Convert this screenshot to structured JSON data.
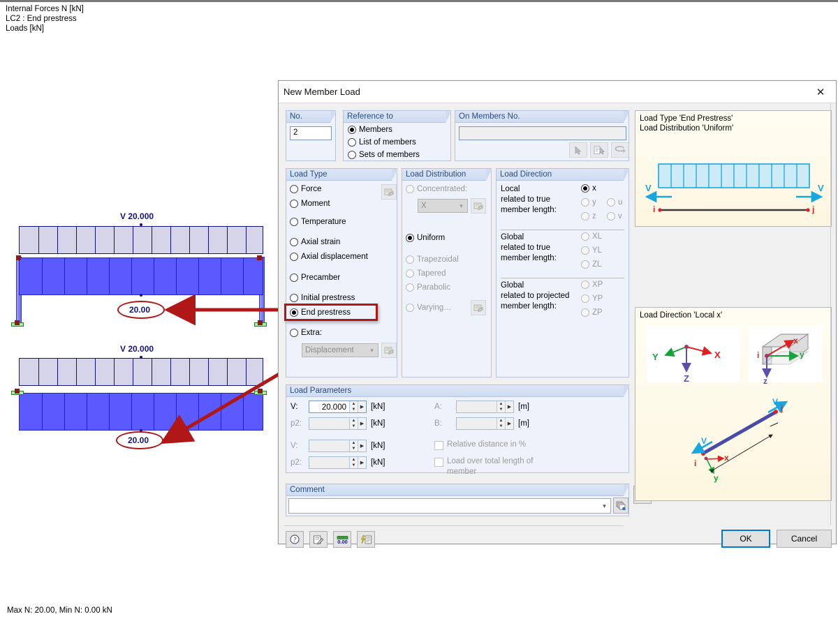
{
  "cad": {
    "header_lines": [
      "Internal Forces N [kN]",
      "LC2 : End prestress",
      "Loads [kN]"
    ],
    "status": "Max N: 20.00, Min N: 0.00 kN",
    "diagram_top": {
      "v_label": "V 20.000",
      "value_label": "20.00"
    },
    "diagram_bottom": {
      "v_label": "V 20.000",
      "value_label": "20.00"
    }
  },
  "dialog": {
    "title": "New Member Load",
    "close_icon": "close-icon",
    "no_group": {
      "title": "No.",
      "value": "2"
    },
    "reference_group": {
      "title": "Reference to",
      "options": [
        {
          "label": "Members",
          "selected": true
        },
        {
          "label": "List of members",
          "selected": false
        },
        {
          "label": "Sets of members",
          "selected": false
        }
      ]
    },
    "on_members_group": {
      "title": "On Members No.",
      "value": "",
      "buttons": [
        {
          "name": "pick-member-button"
        },
        {
          "name": "pick-member-list-button"
        },
        {
          "name": "select-all-button"
        }
      ]
    },
    "load_type_group": {
      "title": "Load Type",
      "options": [
        {
          "label": "Force",
          "selected": false,
          "disabled": false
        },
        {
          "label": "Moment",
          "selected": false,
          "disabled": false
        },
        {
          "label": "Temperature",
          "selected": false,
          "disabled": false
        },
        {
          "label": "Axial strain",
          "selected": false,
          "disabled": false
        },
        {
          "label": "Axial displacement",
          "selected": false,
          "disabled": false
        },
        {
          "label": "Precamber",
          "selected": false,
          "disabled": false
        },
        {
          "label": "Initial prestress",
          "selected": false,
          "disabled": false
        },
        {
          "label": "End prestress",
          "selected": true,
          "disabled": false,
          "highlight": true
        },
        {
          "label": "Extra:",
          "selected": false,
          "disabled": false
        }
      ],
      "extra_dropdown": {
        "value": "Displacement",
        "disabled": true
      },
      "settings_button": "settings-icon"
    },
    "load_distribution_group": {
      "title": "Load Distribution",
      "options": [
        {
          "label": "Concentrated:",
          "selected": false,
          "disabled": true
        },
        {
          "label": "Uniform",
          "selected": true,
          "disabled": false
        },
        {
          "label": "Trapezoidal",
          "selected": false,
          "disabled": true
        },
        {
          "label": "Tapered",
          "selected": false,
          "disabled": true
        },
        {
          "label": "Parabolic",
          "selected": false,
          "disabled": true
        },
        {
          "label": "Varying…",
          "selected": false,
          "disabled": true
        }
      ],
      "concentrated_dropdown": {
        "value": "X",
        "disabled": true
      }
    },
    "load_direction_group": {
      "title": "Load Direction",
      "sections": [
        {
          "label": "Local\nrelated to true\nmember length:",
          "options": [
            {
              "label": "x",
              "selected": true,
              "disabled": false
            },
            {
              "label": "u",
              "selected": false,
              "disabled": true
            },
            {
              "label": "y",
              "selected": false,
              "disabled": true
            },
            {
              "label": "v",
              "selected": false,
              "disabled": true
            },
            {
              "label": "z",
              "selected": false,
              "disabled": true
            }
          ]
        },
        {
          "label": "Global\nrelated to true\nmember length:",
          "options": [
            {
              "label": "XL",
              "selected": false,
              "disabled": true
            },
            {
              "label": "YL",
              "selected": false,
              "disabled": true
            },
            {
              "label": "ZL",
              "selected": false,
              "disabled": true
            }
          ]
        },
        {
          "label": "Global\nrelated to projected\nmember length:",
          "options": [
            {
              "label": "XP",
              "selected": false,
              "disabled": true
            },
            {
              "label": "YP",
              "selected": false,
              "disabled": true
            },
            {
              "label": "ZP",
              "selected": false,
              "disabled": true
            }
          ]
        }
      ],
      "local_label_l1": "Local",
      "local_label_l2": "related to true",
      "local_label_l3": "member length:",
      "global_true_l1": "Global",
      "global_true_l2": "related to true",
      "global_true_l3": "member length:",
      "global_proj_l1": "Global",
      "global_proj_l2": "related to projected",
      "global_proj_l3": "member length:"
    },
    "load_parameters_group": {
      "title": "Load Parameters",
      "fields": [
        {
          "label": "V:",
          "value": "20.000",
          "unit": "[kN]",
          "disabled": false
        },
        {
          "label": "p2:",
          "value": "",
          "unit": "[kN]",
          "disabled": true
        },
        {
          "label": "V:",
          "value": "",
          "unit": "[kN]",
          "disabled": true
        },
        {
          "label": "p2:",
          "value": "",
          "unit": "[kN]",
          "disabled": true
        },
        {
          "label": "A:",
          "value": "",
          "unit": "[m]",
          "disabled": true
        },
        {
          "label": "B:",
          "value": "",
          "unit": "[m]",
          "disabled": true
        }
      ],
      "checkboxes": [
        {
          "label": "Relative distance in %",
          "checked": false,
          "disabled": true
        },
        {
          "label": "Load over total length of",
          "label2": "member",
          "checked": false,
          "disabled": true
        }
      ]
    },
    "comment_group": {
      "title": "Comment",
      "value": "",
      "dropdown_icon": "chevron-down-icon",
      "library_button": "comment-library-icon"
    },
    "preview_load_type": {
      "line1": "Load Type 'End Prestress'",
      "line2": "Load Distribution 'Uniform'",
      "node_i": "i",
      "node_j": "j",
      "arrow_label_left": "V",
      "arrow_label_right": "V"
    },
    "preview_direction": {
      "title": "Load Direction 'Local x'",
      "axes_global": {
        "x": "X",
        "y": "Y",
        "z": "Z"
      },
      "axes_local": {
        "x": "x",
        "y": "y",
        "z": "z",
        "node": "i"
      }
    },
    "preview_member": {
      "node_i": "i",
      "node_j": "j",
      "v_left": "V",
      "v_right": "V",
      "axis_x": "x",
      "axis_y": "y"
    },
    "render_button": "render-view-icon",
    "footer_tools": [
      {
        "name": "help-button",
        "icon": "question-icon"
      },
      {
        "name": "edit-button",
        "icon": "edit-icon"
      },
      {
        "name": "units-button",
        "icon": "units-icon"
      },
      {
        "name": "settings-list-button",
        "icon": "lightning-list-icon"
      }
    ],
    "ok_label": "OK",
    "cancel_label": "Cancel"
  },
  "colors": {
    "accent": "#0078d7",
    "group_header_text": "#2c4b80",
    "highlight_red": "#b01818",
    "force_blue": "#5a5aff",
    "load_band": "#d5d4e8",
    "preview_bg": "#fdf6e0"
  }
}
